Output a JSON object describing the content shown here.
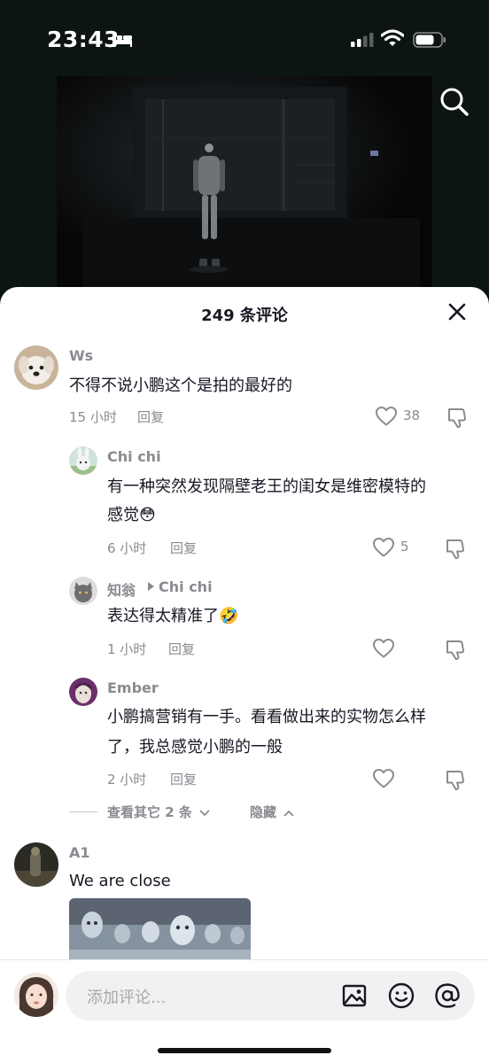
{
  "status_bar": {
    "time": "23:43"
  },
  "comments_sheet": {
    "title": "249 条评论",
    "comments": [
      {
        "username": "Ws",
        "text": "不得不说小鹏这个是拍的最好的",
        "time": "15 小时",
        "reply": "回复",
        "likes": "38"
      },
      {
        "username": "Chi chi",
        "text_line1": "有一种突然发现隔壁老王的闺女是维密模特的",
        "text_line2": "感觉😳",
        "time": "6 小时",
        "reply": "回复",
        "likes": "5"
      },
      {
        "username": "知翁",
        "reply_to": "Chi chi",
        "text": "表达得太精准了🤣",
        "time": "1 小时",
        "reply": "回复"
      },
      {
        "username": "Ember",
        "text_line1": "小鹏搞营销有一手。看看做出来的实物怎么样",
        "text_line2": "了，我总感觉小鹏的一般",
        "time": "2 小时",
        "reply": "回复"
      },
      {
        "username": "A1",
        "text": "We are close"
      }
    ],
    "view_more": "查看其它 2 条",
    "hide": "隐藏"
  },
  "input": {
    "placeholder": "添加评论..."
  },
  "icons": [
    "sleep-icon",
    "signal-icon",
    "wifi-icon",
    "battery-icon",
    "search-icon",
    "close-icon",
    "heart-icon",
    "thumbs-down-icon",
    "image-icon",
    "emoji-icon",
    "mention-icon",
    "chevron-down-icon",
    "chevron-up-icon"
  ],
  "colors": {
    "text": "#161823",
    "secondary": "#8a8b91",
    "input_bg": "#f1f1f2"
  }
}
